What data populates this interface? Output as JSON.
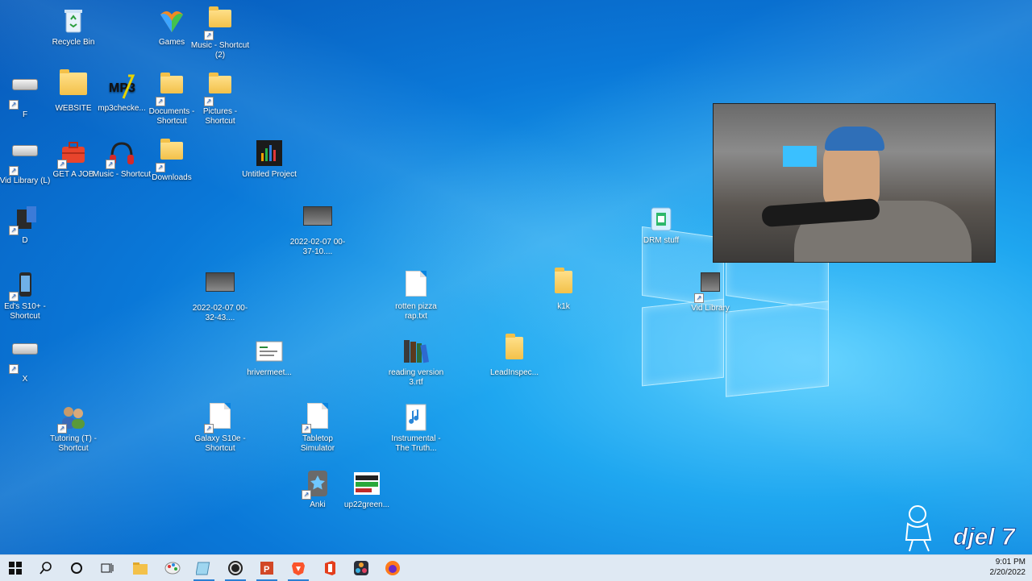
{
  "desktop": {
    "icons": [
      {
        "label": "Recycle Bin",
        "icon": "recycle-bin-icon"
      },
      {
        "label": "Games",
        "icon": "games-icon"
      },
      {
        "label": "Music - Shortcut (2)",
        "icon": "folder-icon"
      },
      {
        "label": "F",
        "icon": "drive-icon"
      },
      {
        "label": "WEBSITE",
        "icon": "folder-icon"
      },
      {
        "label": "mp3checke...",
        "icon": "mp3-icon"
      },
      {
        "label": "Documents - Shortcut",
        "icon": "folder-icon"
      },
      {
        "label": "Pictures - Shortcut",
        "icon": "folder-icon"
      },
      {
        "label": "Vid Library (L)",
        "icon": "drive-icon"
      },
      {
        "label": "GET A JOB",
        "icon": "briefcase-icon"
      },
      {
        "label": "Music - Shortcut",
        "icon": "headphones-icon"
      },
      {
        "label": "Downloads",
        "icon": "folder-icon"
      },
      {
        "label": "Untitled Project",
        "icon": "video-project-icon"
      },
      {
        "label": "D",
        "icon": "drive-icon"
      },
      {
        "label": "2022-02-07 00-37-10....",
        "icon": "video-thumbnail-icon"
      },
      {
        "label": "DRM stuff",
        "icon": "app-icon"
      },
      {
        "label": "Ed's S10+ - Shortcut",
        "icon": "phone-icon"
      },
      {
        "label": "2022-02-07 00-32-43....",
        "icon": "video-thumbnail-icon"
      },
      {
        "label": "rotten pizza rap.txt",
        "icon": "text-file-icon"
      },
      {
        "label": "k1k",
        "icon": "folder-icon"
      },
      {
        "label": "Vid Library",
        "icon": "video-library-icon"
      },
      {
        "label": "X",
        "icon": "drive-icon"
      },
      {
        "label": "hrivermeet...",
        "icon": "document-icon"
      },
      {
        "label": "reading version 3.rtf",
        "icon": "books-icon"
      },
      {
        "label": "LeadInspec...",
        "icon": "folder-icon"
      },
      {
        "label": "Tutoring (T) - Shortcut",
        "icon": "users-icon"
      },
      {
        "label": "Galaxy S10e - Shortcut",
        "icon": "blank-file-icon"
      },
      {
        "label": "Tabletop Simulator",
        "icon": "blank-file-icon"
      },
      {
        "label": "Instrumental - The Truth...",
        "icon": "music-file-icon"
      },
      {
        "label": "Anki",
        "icon": "anki-icon"
      },
      {
        "label": "up22green...",
        "icon": "image-file-icon"
      }
    ]
  },
  "watermark": {
    "text": "djel 7"
  },
  "taskbar": {
    "buttons": [
      {
        "name": "start",
        "icon": "windows-start-icon"
      },
      {
        "name": "search",
        "icon": "search-icon"
      },
      {
        "name": "cortana",
        "icon": "cortana-circle-icon"
      },
      {
        "name": "task-view",
        "icon": "task-view-icon"
      },
      {
        "name": "file-explorer",
        "icon": "folder-icon"
      },
      {
        "name": "paint",
        "icon": "paint-icon"
      },
      {
        "name": "notepad",
        "icon": "notepad-icon"
      },
      {
        "name": "obs",
        "icon": "obs-icon"
      },
      {
        "name": "powerpoint",
        "icon": "powerpoint-icon"
      },
      {
        "name": "brave",
        "icon": "brave-icon"
      },
      {
        "name": "office",
        "icon": "office-icon"
      },
      {
        "name": "davinci",
        "icon": "davinci-icon"
      },
      {
        "name": "firefox",
        "icon": "firefox-icon"
      }
    ],
    "clock": {
      "time": "9:01 PM",
      "date": "2/20/2022"
    }
  },
  "colors": {
    "wallpaper": "#0a78d8",
    "taskbar": "#dfe9f3",
    "accent": "#2a7fd4"
  }
}
